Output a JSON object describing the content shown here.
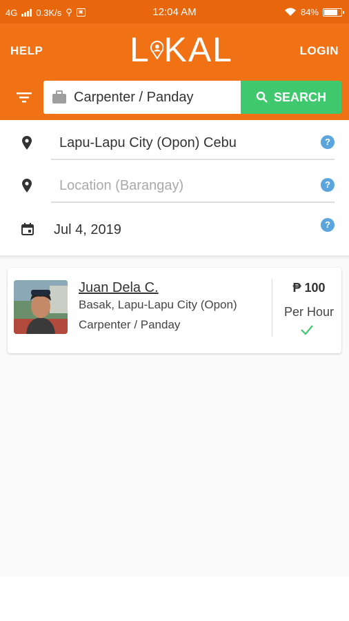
{
  "status_bar": {
    "network": "4G",
    "speed": "0.3K/s",
    "time": "12:04 AM",
    "battery_text": "84%",
    "battery_level": 0.84
  },
  "header": {
    "help_label": "HELP",
    "login_label": "LOGIN",
    "logo_text_left": "L",
    "logo_text_right": "KAL",
    "brand_color": "#f07215"
  },
  "search": {
    "category_value": "Carpenter / Panday",
    "button_label": "SEARCH",
    "button_color": "#3fc86e"
  },
  "form": {
    "city_value": "Lapu-Lapu City (Opon) Cebu",
    "barangay_placeholder": "Location (Barangay)",
    "date_value": "Jul 4, 2019",
    "help_glyph": "?"
  },
  "results": [
    {
      "name": "Juan Dela C.",
      "address": "Basak, Lapu-Lapu City (Opon)",
      "category": "Carpenter / Panday",
      "rate": "₱ 100",
      "rate_unit": "Per Hour",
      "verified": true
    }
  ]
}
